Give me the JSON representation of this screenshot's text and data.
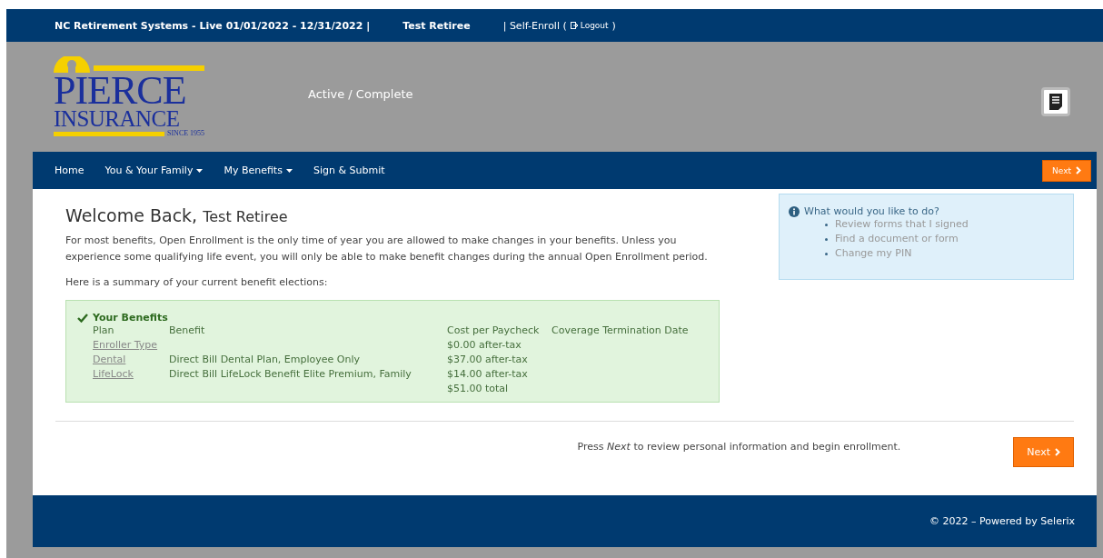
{
  "top_bar": {
    "system": "NC Retirement Systems - Live 01/01/2022 - 12/31/2022 |",
    "user": "Test Retiree",
    "mode": "| Self-Enroll (",
    "logout": "Logout",
    "close_paren": ")"
  },
  "logo": {
    "line1": "PIERCE",
    "line2": "INSURANCE",
    "since": "SINCE 1955"
  },
  "status": "Active / Complete",
  "nav": {
    "items": [
      {
        "label": "Home",
        "dropdown": false
      },
      {
        "label": "You & Your Family",
        "dropdown": true
      },
      {
        "label": "My Benefits",
        "dropdown": true
      },
      {
        "label": "Sign & Submit",
        "dropdown": false
      }
    ],
    "next": "Next"
  },
  "welcome": {
    "title": "Welcome Back,",
    "name": "Test Retiree",
    "intro": "For most benefits, Open Enrollment is the only time of year you are allowed to make changes in your benefits. Unless you experience some qualifying life event, you will only be able to make benefit changes during the annual Open Enrollment period.",
    "summary": "Here is a summary of your current benefit elections:"
  },
  "benefits": {
    "title": "Your Benefits",
    "columns": [
      "Plan",
      "Benefit",
      "Cost per Paycheck",
      "Coverage Termination Date"
    ],
    "rows": [
      {
        "plan": "Enroller Type",
        "benefit": "",
        "cost": "$0.00 after-tax"
      },
      {
        "plan": "Dental",
        "benefit": "Direct Bill Dental Plan, Employee Only",
        "cost": "$37.00 after-tax"
      },
      {
        "plan": "LifeLock",
        "benefit": "Direct Bill LifeLock Benefit Elite Premium, Family",
        "cost": "$14.00 after-tax"
      }
    ],
    "total": "$51.00 total"
  },
  "help": {
    "title": "What would you like to do?",
    "links": [
      "Review forms that I signed",
      "Find a document or form",
      "Change my PIN"
    ]
  },
  "bottom": {
    "text": "Press *Next* to review personal information and begin enrollment.",
    "next": "Next"
  },
  "footer": "© 2022 – Powered by Selerix"
}
